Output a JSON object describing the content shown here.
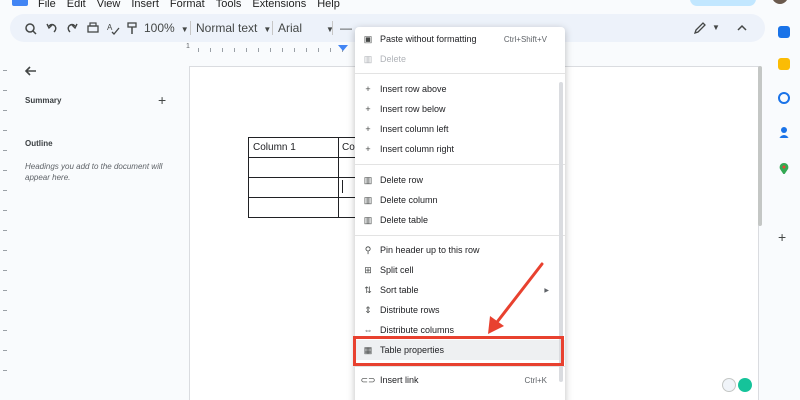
{
  "menubar": {
    "items": [
      "File",
      "Edit",
      "View",
      "Insert",
      "Format",
      "Tools",
      "Extensions",
      "Help"
    ]
  },
  "toolbar": {
    "zoom": "100%",
    "style": "Normal text",
    "font": "Arial",
    "font_size_minus": "—"
  },
  "outline_panel": {
    "summary_label": "Summary",
    "outline_label": "Outline",
    "outline_hint": "Headings you add to the document will appear here."
  },
  "document": {
    "table": {
      "row1": [
        "Column 1",
        "Co"
      ]
    }
  },
  "context_menu": {
    "items": [
      {
        "label": "Paste without formatting",
        "shortcut": "Ctrl+Shift+V",
        "icon": "clipboard-icon",
        "glyph": "▣"
      },
      {
        "label": "Delete",
        "shortcut": "",
        "icon": "trash-icon",
        "glyph": "🗑",
        "disabled": true
      },
      {
        "label": "Insert row above",
        "shortcut": "",
        "icon": "plus-icon",
        "glyph": "+"
      },
      {
        "label": "Insert row below",
        "shortcut": "",
        "icon": "plus-icon",
        "glyph": "+"
      },
      {
        "label": "Insert column left",
        "shortcut": "",
        "icon": "plus-icon",
        "glyph": "+"
      },
      {
        "label": "Insert column right",
        "shortcut": "",
        "icon": "plus-icon",
        "glyph": "+"
      },
      {
        "label": "Delete row",
        "shortcut": "",
        "icon": "trash-icon",
        "glyph": "▥"
      },
      {
        "label": "Delete column",
        "shortcut": "",
        "icon": "trash-icon",
        "glyph": "▥"
      },
      {
        "label": "Delete table",
        "shortcut": "",
        "icon": "trash-icon",
        "glyph": "▥"
      },
      {
        "label": "Pin header up to this row",
        "shortcut": "",
        "icon": "pin-icon",
        "glyph": "⚲"
      },
      {
        "label": "Split cell",
        "shortcut": "",
        "icon": "split-cell-icon",
        "glyph": "⊞"
      },
      {
        "label": "Sort table",
        "shortcut": "",
        "icon": "sort-icon",
        "glyph": "⇅"
      },
      {
        "label": "Distribute rows",
        "shortcut": "",
        "icon": "distribute-rows-icon",
        "glyph": "⇕"
      },
      {
        "label": "Distribute columns",
        "shortcut": "",
        "icon": "distribute-columns-icon",
        "glyph": "⇔"
      },
      {
        "label": "Table properties",
        "shortcut": "",
        "icon": "table-icon",
        "glyph": "▦"
      },
      {
        "label": "Insert link",
        "shortcut": "Ctrl+K",
        "icon": "link-icon",
        "glyph": "⊂⊃"
      }
    ]
  },
  "colors": {
    "accent_blue": "#4285f4",
    "annotation_red": "#e8412f",
    "toolbar_bg": "#edf2fa"
  }
}
